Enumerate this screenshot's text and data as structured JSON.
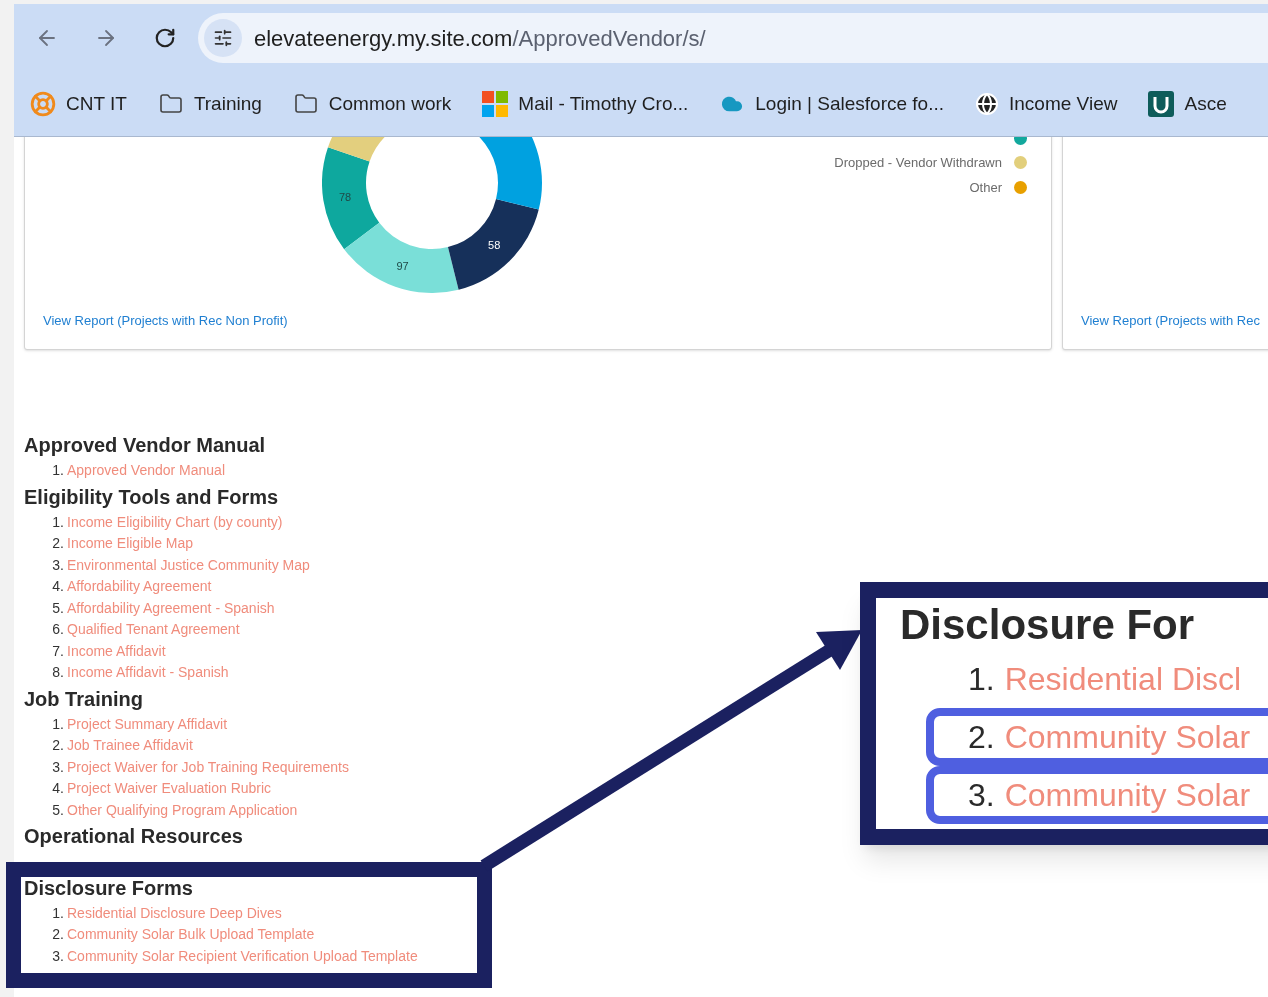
{
  "browser": {
    "url": {
      "host": "elevateenergy.my.site.com",
      "path": "/ApprovedVendor/s/"
    },
    "bookmarks": [
      {
        "kind": "lifebuoy",
        "label": "CNT IT"
      },
      {
        "kind": "folder",
        "label": "Training"
      },
      {
        "kind": "folder",
        "label": "Common work"
      },
      {
        "kind": "windows",
        "label": "Mail - Timothy Cro..."
      },
      {
        "kind": "cloud",
        "label": "Login | Salesforce fo..."
      },
      {
        "kind": "globe",
        "label": "Income View"
      },
      {
        "kind": "app",
        "label": "Asce"
      }
    ]
  },
  "chart_card": {
    "donut": {
      "slices": [
        {
          "label": "78",
          "color": "#0ea89e"
        },
        {
          "label": "97",
          "color": "#7adfd8"
        },
        {
          "label": "58",
          "color": "#16305a"
        },
        {
          "color": "#00a1e0"
        },
        {
          "color": "#e3cf7e"
        }
      ]
    },
    "legend": [
      {
        "color": "#12a89d"
      },
      {
        "label": "Dropped - Vendor Withdrawn",
        "color": "#e2cf7c"
      },
      {
        "label": "Other",
        "color": "#e8a000"
      }
    ],
    "link": "View Report (Projects with Rec Non Profit)"
  },
  "second_card": {
    "link": "View Report (Projects with Rec"
  },
  "sections": [
    {
      "heading": "Approved Vendor Manual",
      "items": [
        {
          "number": "1.",
          "label": "Approved Vendor Manual"
        }
      ]
    },
    {
      "heading": "Eligibility Tools and Forms",
      "items": [
        {
          "number": "1.",
          "label": "Income Eligibility Chart (by county)"
        },
        {
          "number": "2.",
          "label": "Income Eligible Map"
        },
        {
          "number": "3.",
          "label": "Environmental Justice Community Map"
        },
        {
          "number": "4.",
          "label": "Affordability Agreement"
        },
        {
          "number": "5.",
          "label": "Affordability Agreement - Spanish"
        },
        {
          "number": "6.",
          "label": "Qualified Tenant Agreement"
        },
        {
          "number": "7.",
          "label": "Income Affidavit"
        },
        {
          "number": "8.",
          "label": "Income Affidavit - Spanish"
        }
      ]
    },
    {
      "heading": "Job Training",
      "items": [
        {
          "number": "1.",
          "label": "Project Summary Affidavit"
        },
        {
          "number": "2.",
          "label": "Job Trainee Affidavit"
        },
        {
          "number": "3.",
          "label": "Project Waiver for Job Training Requirements"
        },
        {
          "number": "4.",
          "label": "Project Waiver Evaluation Rubric"
        },
        {
          "number": "5.",
          "label": "Other Qualifying Program Application"
        }
      ]
    },
    {
      "heading": "Operational Resources"
    },
    {
      "heading": "Disclosure Forms",
      "items": [
        {
          "number": "1.",
          "label": "Residential Disclosure Deep Dives"
        },
        {
          "number": "2.",
          "label": "Community Solar Bulk Upload Template"
        },
        {
          "number": "3.",
          "label": "Community Solar Recipient Verification Upload Template"
        }
      ]
    }
  ],
  "callout": {
    "heading": "Disclosure For",
    "items": [
      {
        "number": "1.",
        "label": "Residential Discl",
        "highlighted": false
      },
      {
        "number": "2.",
        "label": "Community Solar",
        "highlighted": true
      },
      {
        "number": "3.",
        "label": "Community Solar",
        "highlighted": true
      }
    ]
  }
}
